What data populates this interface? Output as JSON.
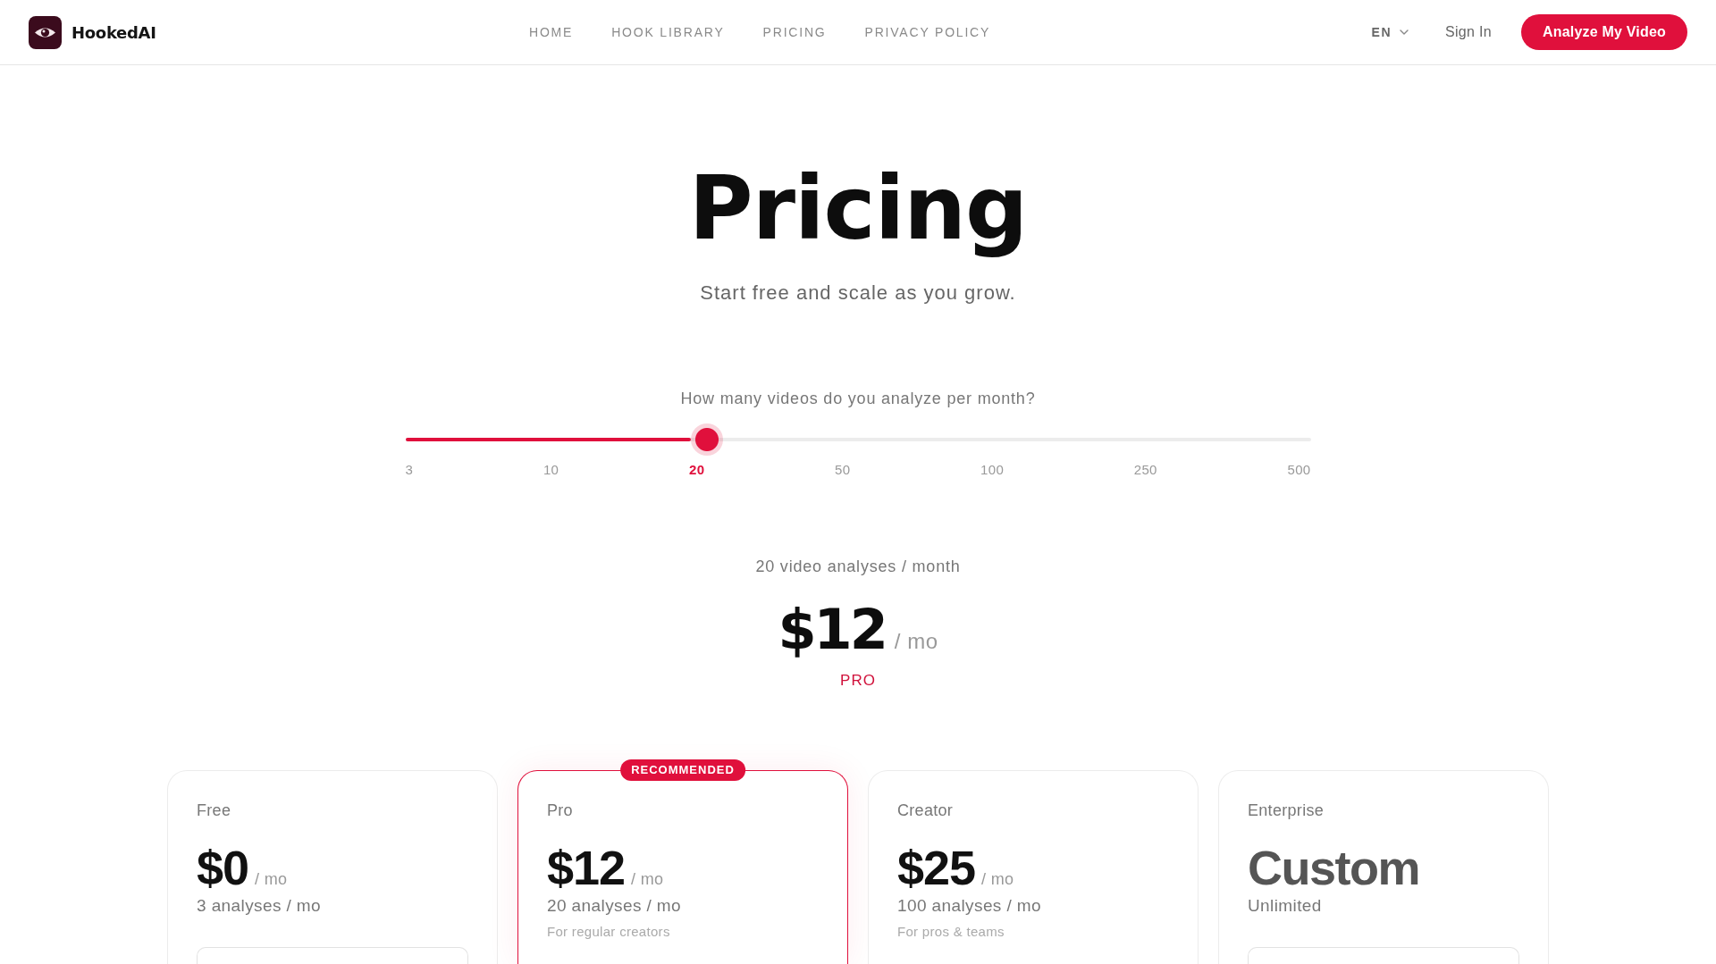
{
  "header": {
    "brand": "HookedAI",
    "nav": [
      "HOME",
      "HOOK LIBRARY",
      "PRICING",
      "PRIVACY POLICY"
    ],
    "language": "EN",
    "sign_in": "Sign In",
    "cta": "Analyze My Video"
  },
  "hero": {
    "title": "Pricing",
    "subtitle": "Start free and scale as you grow."
  },
  "calculator": {
    "question": "How many videos do you analyze per month?",
    "slider": {
      "level": 0.333
    },
    "ticks": [
      {
        "label": "3",
        "selected": false
      },
      {
        "label": "10",
        "selected": false
      },
      {
        "label": "20",
        "selected": true
      },
      {
        "label": "50",
        "selected": false
      },
      {
        "label": "100",
        "selected": false
      },
      {
        "label": "250",
        "selected": false
      },
      {
        "label": "500",
        "selected": false
      }
    ],
    "summary": "20 video analyses / month",
    "price": "$12",
    "period": "/ mo",
    "plan": "PRO"
  },
  "plans": [
    {
      "kind": "priced",
      "name": "Free",
      "price": "$0",
      "period": "/ mo",
      "quota": "3 analyses / mo",
      "recommended": false
    },
    {
      "kind": "priced",
      "name": "Pro",
      "price": "$12",
      "period": "/ mo",
      "quota": "20 analyses / mo",
      "note": "For regular creators",
      "recommended": true,
      "badge": "RECOMMENDED"
    },
    {
      "kind": "priced",
      "name": "Creator",
      "price": "$25",
      "period": "/ mo",
      "quota": "100 analyses / mo",
      "note": "For pros & teams",
      "recommended": false
    },
    {
      "kind": "custom",
      "name": "Enterprise",
      "price": "Custom",
      "quota": "Unlimited",
      "recommended": false
    }
  ]
}
